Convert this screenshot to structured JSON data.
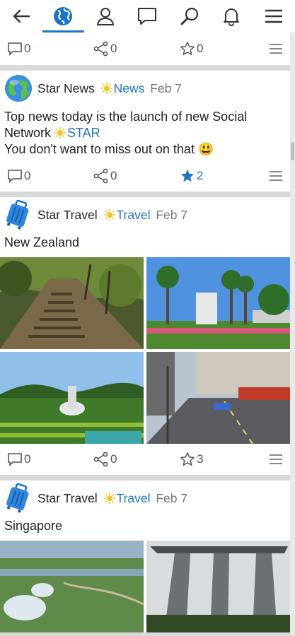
{
  "nav": [
    {
      "name": "back-icon"
    },
    {
      "name": "globe-icon",
      "active": true
    },
    {
      "name": "person-icon"
    },
    {
      "name": "chat-icon"
    },
    {
      "name": "search-icon"
    },
    {
      "name": "bell-icon"
    },
    {
      "name": "hamburger-menu-icon"
    }
  ],
  "top_actions": {
    "comments": "0",
    "shares": "0",
    "stars": "0"
  },
  "posts": [
    {
      "author": "Star News",
      "category": "News",
      "date": "Feb 7",
      "text_line1": "Top news today is the launch of new Social",
      "text_line2_prefix": "Network ",
      "text_line2_tag": "STAR",
      "text_line3": "You don't want to miss out on that 😃",
      "comments": "0",
      "shares": "0",
      "stars": "2"
    },
    {
      "author": "Star Travel",
      "category": "Travel",
      "date": "Feb 7",
      "title": "New Zealand",
      "comments": "0",
      "shares": "0",
      "stars": "3"
    },
    {
      "author": "Star Travel",
      "category": "Travel",
      "date": "Feb 7",
      "title": "Singapore"
    }
  ],
  "colors": {
    "accent": "#1e73c9",
    "star_gold": "#f6c21b"
  }
}
